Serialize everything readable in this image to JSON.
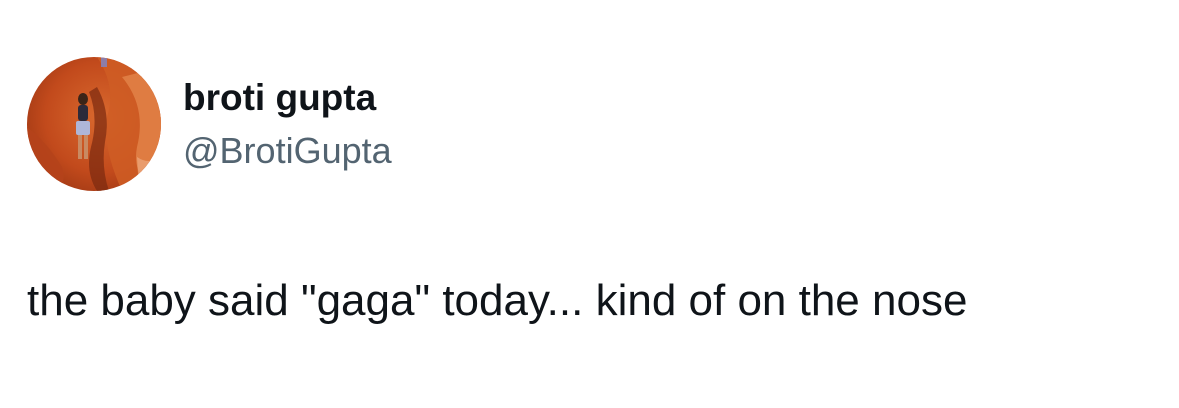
{
  "tweet": {
    "author": {
      "display_name": "broti gupta",
      "handle": "@BrotiGupta"
    },
    "text": "the baby said \"gaga\" today... kind of on the nose"
  },
  "colors": {
    "text_primary": "#0f1419",
    "text_secondary": "#536471",
    "background": "#ffffff"
  }
}
